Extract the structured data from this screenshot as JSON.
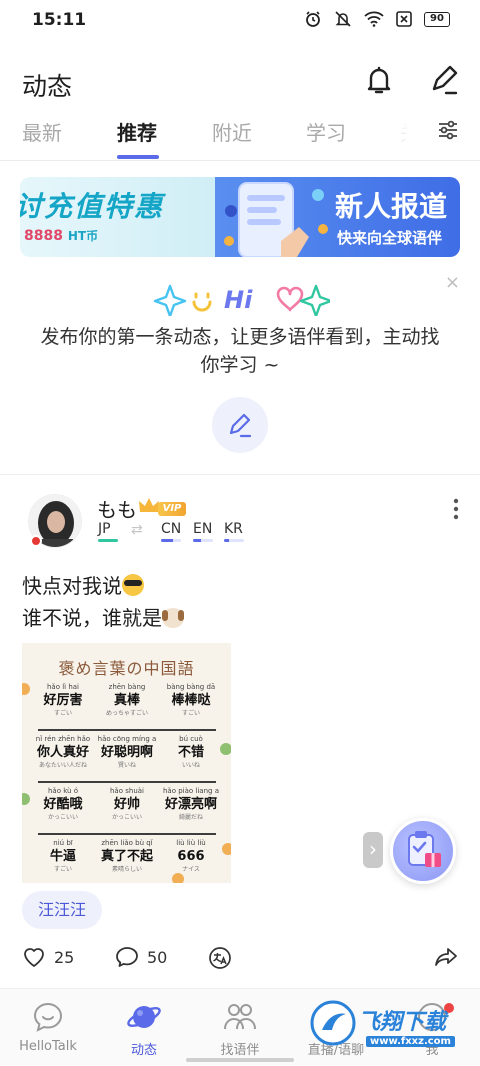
{
  "status_bar": {
    "time": "15:11",
    "battery": "90"
  },
  "header": {
    "title": "动态"
  },
  "tabs": [
    {
      "label": "最新",
      "active": false
    },
    {
      "label": "推荐",
      "active": true
    },
    {
      "label": "附近",
      "active": false
    },
    {
      "label": "学习",
      "active": false
    },
    {
      "label": "关",
      "active": false
    }
  ],
  "banner": {
    "left_title": "讨充值特惠",
    "left_amount": "8888",
    "left_currency": "HT币",
    "right_title": "新人报道",
    "right_sub": "快来向全球语伴"
  },
  "prompt": {
    "deco_text": "Hi",
    "text": "发布你的第一条动态，让更多语伴看到，主动找你学习 ~",
    "close": "×"
  },
  "post": {
    "username": "もも",
    "vip": "VIP",
    "langs": [
      {
        "code": "JP",
        "bar": "#2fc6a0"
      },
      {
        "code": "CN",
        "bar": "#5b6ae8"
      },
      {
        "code": "EN",
        "bar": "#5b6ae8"
      },
      {
        "code": "KR",
        "bar": "#5b6ae8"
      }
    ],
    "line1": "快点对我说",
    "line2": "谁不说，谁就是",
    "image": {
      "title": "褒め言葉の中国語",
      "rows": [
        [
          {
            "py": "hǎo lì hai",
            "cn": "好厉害",
            "jp": "すごい"
          },
          {
            "py": "zhēn bàng",
            "cn": "真棒",
            "jp": "めっちゃすごい"
          },
          {
            "py": "bàng bàng dā",
            "cn": "棒棒哒",
            "jp": "すごい"
          }
        ],
        [
          {
            "py": "nǐ rén zhēn hǎo",
            "cn": "你人真好",
            "jp": "あなたいい人だね"
          },
          {
            "py": "hǎo cōng míng a",
            "cn": "好聪明啊",
            "jp": "賢いね"
          },
          {
            "py": "bú cuò",
            "cn": "不错",
            "jp": "いいね"
          }
        ],
        [
          {
            "py": "hǎo kù ó",
            "cn": "好酷哦",
            "jp": "かっこいい"
          },
          {
            "py": "hǎo shuài",
            "cn": "好帅",
            "jp": "かっこいい"
          },
          {
            "py": "hǎo piào liang a",
            "cn": "好漂亮啊",
            "jp": "綺麗だね"
          }
        ],
        [
          {
            "py": "niú bī",
            "cn": "牛逼",
            "jp": "すごい"
          },
          {
            "py": "zhēn liǎo bù qǐ",
            "cn": "真了不起",
            "jp": "素晴らしい"
          },
          {
            "py": "liù liù liù",
            "cn": "666",
            "jp": "ナイス"
          }
        ]
      ]
    },
    "tag": "汪汪汪",
    "likes": "25",
    "comments": "50"
  },
  "bottom_nav": [
    {
      "label": "HelloTalk",
      "active": false
    },
    {
      "label": "动态",
      "active": true
    },
    {
      "label": "找语伴",
      "active": false
    },
    {
      "label": "直播/语聊",
      "active": false
    },
    {
      "label": "我",
      "active": false
    }
  ],
  "watermark": {
    "cn": "飞翔下载",
    "url": "www.fxxz.com"
  },
  "colors": {
    "accent": "#5b6ae8",
    "tag_text": "#4a58d8",
    "banner_blue": "#3f6de6"
  }
}
